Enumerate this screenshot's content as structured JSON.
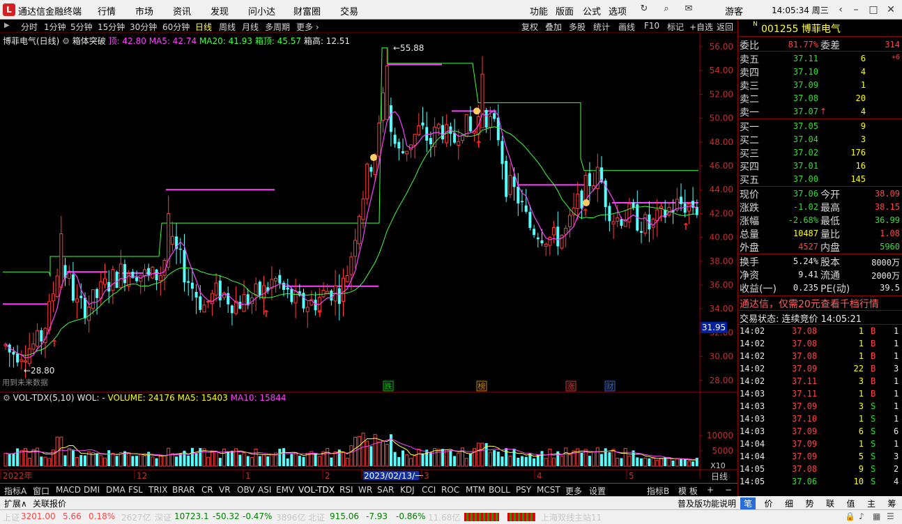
{
  "app": {
    "logo": "L",
    "title": "通达信金融终端"
  },
  "menu": [
    "行情",
    "市场",
    "资讯",
    "发现",
    "问小达",
    "财富圈",
    "交易"
  ],
  "menu_right": [
    "功能",
    "版面",
    "公式",
    "选项"
  ],
  "user": "游客",
  "clock": "14:05:34 周三",
  "periods": [
    "分时",
    "1分钟",
    "5分钟",
    "15分钟",
    "30分钟",
    "60分钟",
    "日线",
    "周线",
    "月线",
    "多周期",
    "更多 ›"
  ],
  "right_tools": [
    "复权",
    "叠加",
    "多股",
    "统计",
    "画线",
    "F10",
    "标记",
    "+自选",
    "返回"
  ],
  "info": {
    "name": "博菲电气(日线)",
    "indicator": "箱体突破",
    "top": "顶: 42.80",
    "ma5": "MA5: 42.74",
    "ma20": "MA20: 41.93",
    "box_top": "箱顶: 45.57",
    "box_high": "箱高: 12.51"
  },
  "y_ticks": [
    "56.00",
    "54.00",
    "52.00",
    "50.00",
    "48.00",
    "46.00",
    "44.00",
    "42.00",
    "40.00",
    "38.00",
    "36.00",
    "34.00",
    "32.00",
    "30.00",
    "28.00"
  ],
  "current_price_tag": "31.95",
  "high_label": "55.88",
  "low_label": "28.80",
  "future_label": "用到未来数据",
  "events": [
    {
      "text": "跌",
      "color": "#00c000"
    },
    {
      "text": "榜",
      "color": "#c08000"
    },
    {
      "text": "涨",
      "color": "#c03030"
    },
    {
      "text": "财",
      "color": "#3060c0"
    }
  ],
  "volume": {
    "name": "VOL-TDX(5,10)",
    "wol": "WOL: -",
    "volume": "VOLUME: 24176",
    "ma5": "MA5: 15403",
    "ma10": "MA10: 15844",
    "ticks": [
      "10000",
      "5000"
    ],
    "unit": "X10"
  },
  "x_labels": [
    "2022年",
    "12",
    "1",
    "2",
    "2023/02/13/一",
    "3",
    "4",
    "5"
  ],
  "x_period": "日线",
  "tabs": [
    "指标A",
    "窗口",
    "MACD",
    "DMI",
    "DMA",
    "FSL",
    "TRIX",
    "BRAR",
    "CR",
    "VR",
    "OBV",
    "ASI",
    "EMV",
    "VOL-TDX",
    "RSI",
    "WR",
    "SAR",
    "KDJ",
    "CCI",
    "ROC",
    "MTM",
    "BOLL",
    "PSY",
    "MCST",
    "更多",
    "设置"
  ],
  "tabs_right": [
    "指标B",
    "模 板",
    "+",
    "−"
  ],
  "ext": [
    "扩展∧",
    "关联报价"
  ],
  "ext_right": "普及版功能说明",
  "rtabs": [
    "笔",
    "价",
    "细",
    "势",
    "联",
    "值",
    "主",
    "筹"
  ],
  "status": {
    "sh_label": "上证",
    "sh": "3201.00",
    "sh_chg": "5.66",
    "sh_pct": "0.18%",
    "sh_amt": "2627亿",
    "sz_label": "深证",
    "sz": "10723.1",
    "sz_chg": "-50.32",
    "sz_pct": "-0.47%",
    "sz_amt": "3896亿",
    "bz_label": "北证",
    "bz": "915.06",
    "bz_chg": "-7.93",
    "bz_pct": "-0.86%",
    "bz_amt": "11.68亿",
    "server": "上海双线主站11"
  },
  "quote": {
    "flag": "N",
    "code": "001255",
    "name": "博菲电气",
    "weibi_label": "委比",
    "weibi": "81.77%",
    "weicha_label": "委差",
    "weicha": "314",
    "asks": [
      {
        "label": "卖五",
        "price": "37.11",
        "vol": "6",
        "extra": "+6"
      },
      {
        "label": "卖四",
        "price": "37.10",
        "vol": "4",
        "extra": ""
      },
      {
        "label": "卖三",
        "price": "37.09",
        "vol": "1",
        "extra": ""
      },
      {
        "label": "卖二",
        "price": "37.08",
        "vol": "20",
        "extra": ""
      },
      {
        "label": "卖一",
        "price": "37.07",
        "vol": "4",
        "extra": ""
      }
    ],
    "bids": [
      {
        "label": "买一",
        "price": "37.05",
        "vol": "9"
      },
      {
        "label": "买二",
        "price": "37.04",
        "vol": "3"
      },
      {
        "label": "买三",
        "price": "37.02",
        "vol": "176"
      },
      {
        "label": "买四",
        "price": "37.01",
        "vol": "16"
      },
      {
        "label": "买五",
        "price": "37.00",
        "vol": "145"
      }
    ],
    "stats": [
      {
        "l1": "现价",
        "v1": "37.06",
        "c1": "green",
        "l2": "今开",
        "v2": "38.09",
        "c2": "red"
      },
      {
        "l1": "涨跌",
        "v1": "-1.02",
        "c1": "green",
        "l2": "最高",
        "v2": "38.15",
        "c2": "red"
      },
      {
        "l1": "涨幅",
        "v1": "-2.68%",
        "c1": "green",
        "l2": "最低",
        "v2": "36.99",
        "c2": "green"
      },
      {
        "l1": "总量",
        "v1": "10487",
        "c1": "yellow",
        "l2": "量比",
        "v2": "1.08",
        "c2": "red"
      },
      {
        "l1": "外盘",
        "v1": "4527",
        "c1": "red",
        "l2": "内盘",
        "v2": "5960",
        "c2": "green"
      }
    ],
    "stats2": [
      {
        "l1": "换手",
        "v1": "5.24%",
        "l2": "股本",
        "v2": "8000万"
      },
      {
        "l1": "净资",
        "v1": "9.41",
        "l2": "流通",
        "v2": "2000万"
      },
      {
        "l1": "收益(一)",
        "v1": "0.235",
        "l2": "PE(动)",
        "v2": "39.5"
      }
    ],
    "promo": "通达信，仅需20元查看千档行情",
    "trade_state": "交易状态: 连续竞价 14:05:21",
    "ticks": [
      {
        "t": "14:02",
        "p": "37.08",
        "v": "1",
        "bs": "B",
        "n": "1"
      },
      {
        "t": "14:02",
        "p": "37.08",
        "v": "1",
        "bs": "B",
        "n": "1"
      },
      {
        "t": "14:02",
        "p": "37.08",
        "v": "1",
        "bs": "B",
        "n": "1"
      },
      {
        "t": "14:02",
        "p": "37.09",
        "v": "22",
        "bs": "B",
        "n": "3"
      },
      {
        "t": "14:02",
        "p": "37.11",
        "v": "3",
        "bs": "B",
        "n": "1"
      },
      {
        "t": "14:03",
        "p": "37.11",
        "v": "1",
        "bs": "B",
        "n": "1"
      },
      {
        "t": "14:03",
        "p": "37.09",
        "v": "3",
        "bs": "S",
        "n": "1"
      },
      {
        "t": "14:03",
        "p": "37.10",
        "v": "1",
        "bs": "S",
        "n": "1"
      },
      {
        "t": "14:03",
        "p": "37.09",
        "v": "6",
        "bs": "S",
        "n": "6"
      },
      {
        "t": "14:04",
        "p": "37.09",
        "v": "1",
        "bs": "S",
        "n": "1"
      },
      {
        "t": "14:04",
        "p": "37.09",
        "v": "5",
        "bs": "S",
        "n": "3"
      },
      {
        "t": "14:05",
        "p": "37.08",
        "v": "9",
        "bs": "S",
        "n": "2"
      },
      {
        "t": "14:05",
        "p": "37.06",
        "v": "10",
        "bs": "S",
        "n": "4"
      }
    ]
  },
  "colors": {
    "up": "#ff3c3c",
    "down": "#54ffff",
    "ma5": "#ff40ff",
    "ma20": "#40ff40",
    "box": "#ff40ff"
  }
}
